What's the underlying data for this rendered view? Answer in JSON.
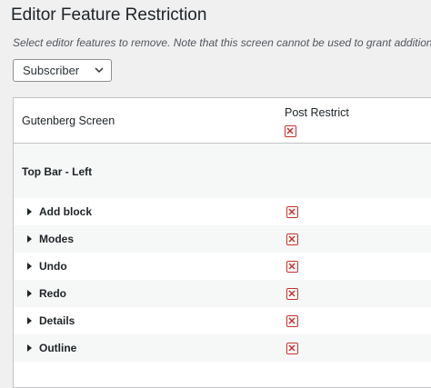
{
  "page": {
    "title": "Editor Feature Restriction",
    "description": "Select editor features to remove. Note that this screen cannot be used to grant additional"
  },
  "role_select": {
    "selected": "Subscriber"
  },
  "table": {
    "column_label": "Gutenberg Screen",
    "column_role": "Post Restrict",
    "section": "Top Bar - Left",
    "rows": [
      {
        "label": "Add block",
        "restricted": true
      },
      {
        "label": "Modes",
        "restricted": true
      },
      {
        "label": "Undo",
        "restricted": true
      },
      {
        "label": "Redo",
        "restricted": true
      },
      {
        "label": "Details",
        "restricted": true
      },
      {
        "label": "Outline",
        "restricted": true
      }
    ]
  },
  "colors": {
    "restrict_red": "#c4312a",
    "background": "#f0f0f1"
  },
  "icons": {
    "restrict": "x-checkbox-icon",
    "expand": "triangle-right-icon",
    "dropdown": "chevron-down-icon"
  }
}
